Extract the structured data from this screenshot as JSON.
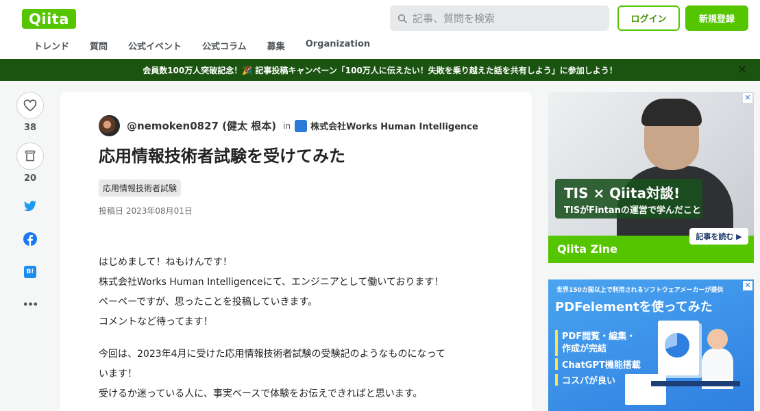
{
  "header": {
    "logo": "Qiita",
    "search_placeholder": "記事、質問を検索",
    "login": "ログイン",
    "signup": "新規登録",
    "nav": [
      "トレンド",
      "質問",
      "公式イベント",
      "公式コラム",
      "募集",
      "Organization"
    ]
  },
  "banner": {
    "text": "会員数100万人突破記念！🎉 記事投稿キャンペーン「100万人に伝えたい！失敗を乗り越えた話を共有しよう」に参加しよう！",
    "close": "✕"
  },
  "rail": {
    "like_count": "38",
    "stock_count": "20",
    "more": "•••",
    "hatena": "B!"
  },
  "article": {
    "author": "@nemoken0827 (健太 根本)",
    "in": "in",
    "organization": "株式会社Works Human Intelligence",
    "title": "応用情報技術者試験を受けてみた",
    "tag": "応用情報技術者試験",
    "date": "投稿日 2023年08月01日",
    "paragraphs": [
      [
        "はじめまして！ねもけんです！",
        "株式会社Works Human Intelligenceにて、エンジニアとして働いております！",
        "ペーペーですが、思ったことを投稿していきます。",
        "コメントなど待ってます！"
      ],
      [
        "今回は、2023年4月に受けた応用情報技術者試験の受験記のようなものになって",
        "います！",
        "受けるか迷っている人に、事実ベースで体験をお伝えできればと思います。"
      ]
    ]
  },
  "ads": {
    "ad1": {
      "title": "TIS × Qiita対談!",
      "subtitle": "TISがFintanの運営で学んだこと",
      "cta": "記事を読む ▶",
      "brand": "Qiita Zine"
    },
    "ad2": {
      "small": "世界150カ国以上で利用されるソフトウェアメーカーが提供",
      "title": "PDFelementを使ってみた",
      "items": [
        "PDF閲覧・編集・",
        "作成が完結",
        "ChatGPT機能搭載",
        "コスパが良い"
      ]
    }
  },
  "colors": {
    "brand": "#55c500",
    "banner": "#1b5410"
  }
}
